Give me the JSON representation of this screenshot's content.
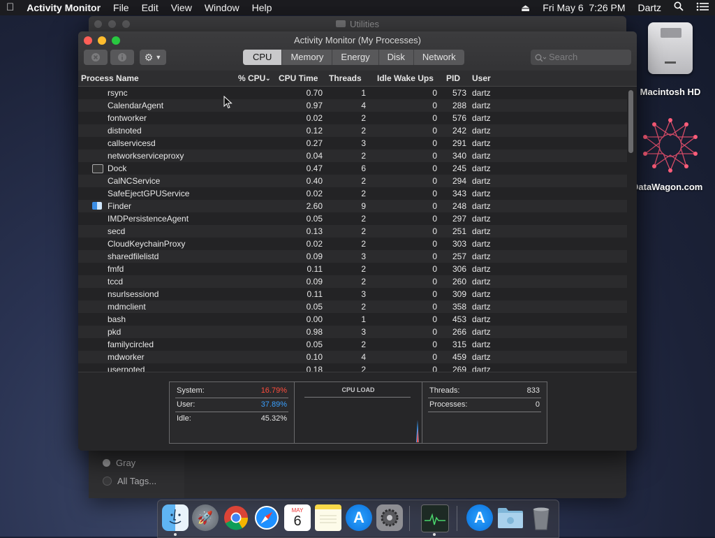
{
  "menubar": {
    "apple_icon": "apple-icon",
    "app_name": "Activity Monitor",
    "menus": [
      "File",
      "Edit",
      "View",
      "Window",
      "Help"
    ],
    "datetime": "Fri May 6  7:26 PM",
    "user": "Dartz"
  },
  "finder_window": {
    "title": "Utilities",
    "tags": [
      {
        "label": "Gray",
        "color": "#9a9a9c"
      },
      {
        "label": "All Tags...",
        "color": "#3a3a3c"
      }
    ]
  },
  "desktop": {
    "icons": [
      {
        "label": "Macintosh HD"
      },
      {
        "label": "DataWagon.com"
      }
    ]
  },
  "window": {
    "title": "Activity Monitor (My Processes)",
    "tabs": [
      "CPU",
      "Memory",
      "Energy",
      "Disk",
      "Network"
    ],
    "selected_tab": "CPU",
    "search_placeholder": "Search"
  },
  "table": {
    "columns": [
      "Process Name",
      "% CPU",
      "CPU Time",
      "Threads",
      "Idle Wake Ups",
      "PID",
      "User"
    ],
    "sort_column": "% CPU",
    "rows": [
      [
        "rsync",
        "",
        "0.70",
        "1",
        "0",
        "573",
        "dartz"
      ],
      [
        "CalendarAgent",
        "",
        "0.97",
        "4",
        "0",
        "288",
        "dartz"
      ],
      [
        "fontworker",
        "",
        "0.02",
        "2",
        "0",
        "576",
        "dartz"
      ],
      [
        "distnoted",
        "",
        "0.12",
        "2",
        "0",
        "242",
        "dartz"
      ],
      [
        "callservicesd",
        "",
        "0.27",
        "3",
        "0",
        "291",
        "dartz"
      ],
      [
        "networkserviceproxy",
        "",
        "0.04",
        "2",
        "0",
        "340",
        "dartz"
      ],
      [
        "Dock",
        "",
        "0.47",
        "6",
        "0",
        "245",
        "dartz"
      ],
      [
        "CalNCService",
        "",
        "0.40",
        "2",
        "0",
        "294",
        "dartz"
      ],
      [
        "SafeEjectGPUService",
        "",
        "0.02",
        "2",
        "0",
        "343",
        "dartz"
      ],
      [
        "Finder",
        "",
        "2.60",
        "9",
        "0",
        "248",
        "dartz"
      ],
      [
        "IMDPersistenceAgent",
        "",
        "0.05",
        "2",
        "0",
        "297",
        "dartz"
      ],
      [
        "secd",
        "",
        "0.13",
        "2",
        "0",
        "251",
        "dartz"
      ],
      [
        "CloudKeychainProxy",
        "",
        "0.02",
        "2",
        "0",
        "303",
        "dartz"
      ],
      [
        "sharedfilelistd",
        "",
        "0.09",
        "3",
        "0",
        "257",
        "dartz"
      ],
      [
        "fmfd",
        "",
        "0.11",
        "2",
        "0",
        "306",
        "dartz"
      ],
      [
        "tccd",
        "",
        "0.09",
        "2",
        "0",
        "260",
        "dartz"
      ],
      [
        "nsurlsessiond",
        "",
        "0.11",
        "3",
        "0",
        "309",
        "dartz"
      ],
      [
        "mdmclient",
        "",
        "0.05",
        "2",
        "0",
        "358",
        "dartz"
      ],
      [
        "bash",
        "",
        "0.00",
        "1",
        "0",
        "453",
        "dartz"
      ],
      [
        "pkd",
        "",
        "0.98",
        "3",
        "0",
        "266",
        "dartz"
      ],
      [
        "familycircled",
        "",
        "0.05",
        "2",
        "0",
        "315",
        "dartz"
      ],
      [
        "mdworker",
        "",
        "0.10",
        "4",
        "0",
        "459",
        "dartz"
      ],
      [
        "usernoted",
        "",
        "0.18",
        "2",
        "0",
        "269",
        "dartz"
      ]
    ],
    "row_icons": {
      "Dock": "dock-icon",
      "Finder": "finder-icon"
    }
  },
  "summary": {
    "system_label": "System:",
    "system_value": "16.79%",
    "system_color": "#ff4d3d",
    "user_label": "User:",
    "user_value": "37.89%",
    "user_color": "#3aa0ff",
    "idle_label": "Idle:",
    "idle_value": "45.32%",
    "cpu_load_title": "CPU LOAD",
    "threads_label": "Threads:",
    "threads_value": "833",
    "processes_label": "Processes:",
    "processes_value": "0"
  },
  "dock": {
    "apps": [
      "Finder",
      "Launchpad",
      "Chrome",
      "Safari",
      "Calendar",
      "Notes",
      "App Store",
      "System Preferences",
      "Activity Monitor",
      "Applications",
      "Documents",
      "Trash"
    ],
    "calendar_month": "MAY",
    "calendar_day": "6"
  }
}
